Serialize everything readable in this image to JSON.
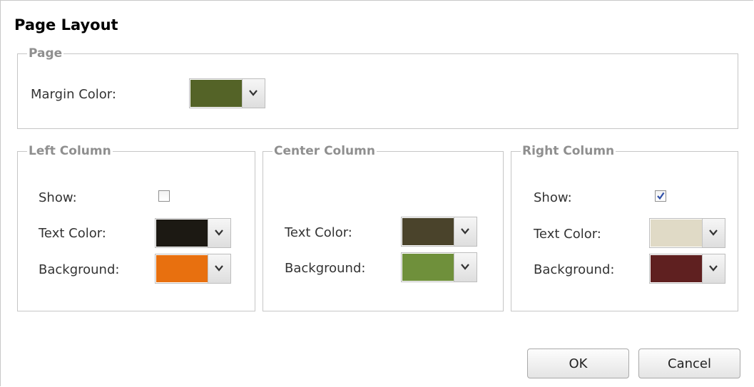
{
  "dialog": {
    "title": "Page Layout"
  },
  "page_section": {
    "legend": "Page",
    "margin_color_label": "Margin Color:",
    "margin_color": "#546327"
  },
  "left_column": {
    "legend": "Left Column",
    "show_label": "Show:",
    "show_checked": false,
    "text_color_label": "Text Color:",
    "text_color": "#1c1913",
    "background_label": "Background:",
    "background_color": "#e8700f"
  },
  "center_column": {
    "legend": "Center Column",
    "text_color_label": "Text Color:",
    "text_color": "#4a432b",
    "background_label": "Background:",
    "background_color": "#6f903b"
  },
  "right_column": {
    "legend": "Right Column",
    "show_label": "Show:",
    "show_checked": true,
    "text_color_label": "Text Color:",
    "text_color": "#e0dac6",
    "background_label": "Background:",
    "background_color": "#5f2020"
  },
  "buttons": {
    "ok": "OK",
    "cancel": "Cancel"
  },
  "icons": {
    "dropdown": "chevron-down-icon",
    "checkmark": "checkmark-icon"
  }
}
